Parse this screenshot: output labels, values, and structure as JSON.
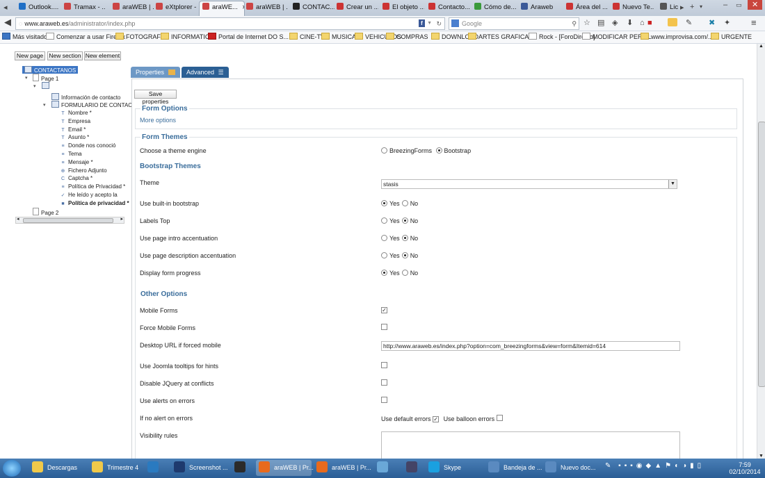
{
  "browser": {
    "tabs": [
      {
        "label": "Outlook....",
        "color": "#1f6fc6"
      },
      {
        "label": "Tramax - ...",
        "color": "#c44"
      },
      {
        "label": "araWEB | ...",
        "color": "#c44"
      },
      {
        "label": "eXtplorer -",
        "color": "#c44"
      },
      {
        "label": "araWE...",
        "color": "#c44",
        "active": true
      },
      {
        "label": "araWEB | ...",
        "color": "#c44"
      },
      {
        "label": "CONTAC...",
        "color": "#222"
      },
      {
        "label": "Crear un ...",
        "color": "#c33"
      },
      {
        "label": "El objeto ...",
        "color": "#c33"
      },
      {
        "label": "Contacto...",
        "color": "#c33"
      },
      {
        "label": "Cómo de...",
        "color": "#3a9a3a"
      },
      {
        "label": "Araweb",
        "color": "#3b5998"
      },
      {
        "label": "Área del ...",
        "color": "#c33"
      },
      {
        "label": "Nuevo Te...",
        "color": "#c33"
      },
      {
        "label": "Lic",
        "color": "#555"
      }
    ],
    "url_host": "www.araweb.es",
    "url_path": "/administrator/index.php",
    "search_placeholder": "Google",
    "bookmarks": [
      "Más visitados",
      "Comenzar a usar Firefox",
      "FOTOGRAFIA",
      "INFORMATICA",
      "Portal de Internet DO S...",
      "CINE-TV",
      "MUSICA",
      "VEHICULOS",
      "COMPRAS",
      "DOWNLOAD",
      "ARTES GRAFICAS",
      "Rock - [ForoDirecto]",
      "MODIFICAR PERFIL",
      "www.improvisa.com/...",
      "URGENTE"
    ]
  },
  "toolbar": {
    "new_page": "New page",
    "new_section": "New section",
    "new_element": "New element"
  },
  "tree": {
    "root": "CONTACTANOS",
    "page1": "Page 1",
    "info": "Información de contacto",
    "form": "FORMULARIO DE CONTACTO",
    "items": [
      "Nombre *",
      "Empresa",
      "Email *",
      "Asunto *",
      "Donde nos conoció",
      "Tema",
      "Mensaje *",
      "Fichero Adjunto",
      "Captcha *",
      "Política de Privacidad *",
      "He leído y acepto la",
      "Política de privacidad *"
    ],
    "page2": "Page 2"
  },
  "tabs": {
    "properties": "Properties",
    "advanced": "Advanced"
  },
  "panel": {
    "save": "Save properties",
    "form_options_title": "Form Options",
    "more_options": "More options",
    "form_themes_title": "Form Themes",
    "theme_engine_label": "Choose a theme engine",
    "engine_opt1": "BreezingForms",
    "engine_opt2": "Bootstrap",
    "bootstrap_themes_title": "Bootstrap Themes",
    "theme_label": "Theme",
    "theme_value": "stasis",
    "yes": "Yes",
    "no": "No",
    "rows": [
      {
        "label": "Use built-in bootstrap",
        "value": "Yes"
      },
      {
        "label": "Labels Top",
        "value": "No"
      },
      {
        "label": "Use page intro accentuation",
        "value": "No"
      },
      {
        "label": "Use page description accentuation",
        "value": "No"
      },
      {
        "label": "Display form progress",
        "value": "Yes"
      }
    ],
    "other_options_title": "Other Options",
    "mobile_forms": "Mobile Forms",
    "force_mobile": "Force Mobile Forms",
    "desktop_url_label": "Desktop URL if forced mobile",
    "desktop_url_value": "http://www.araweb.es/index.php?option=com_breezingforms&view=form&Itemid=614",
    "joomla_tooltips": "Use Joomla tooltips for hints",
    "disable_jquery": "Disable JQuery at conflicts",
    "alerts_errors": "Use alerts on errors",
    "no_alert_label": "If no alert on errors",
    "default_errors": "Use default errors",
    "balloon_errors": "Use balloon errors",
    "visibility_rules": "Visibility rules"
  },
  "taskbar": {
    "items": [
      "Descargas",
      "Trimestre 4",
      "",
      "Screenshot ...",
      "",
      "araWEB | Pr...",
      "araWEB | Pr...",
      "",
      "",
      "Skype",
      "Bandeja de ...",
      "Nuevo doc..."
    ],
    "time": "7:59",
    "date": "02/10/2014"
  },
  "colors": {
    "accent_blue": "#3a6d9b",
    "tab_properties": "#6d98c5",
    "tab_advanced": "#2b5f94"
  }
}
